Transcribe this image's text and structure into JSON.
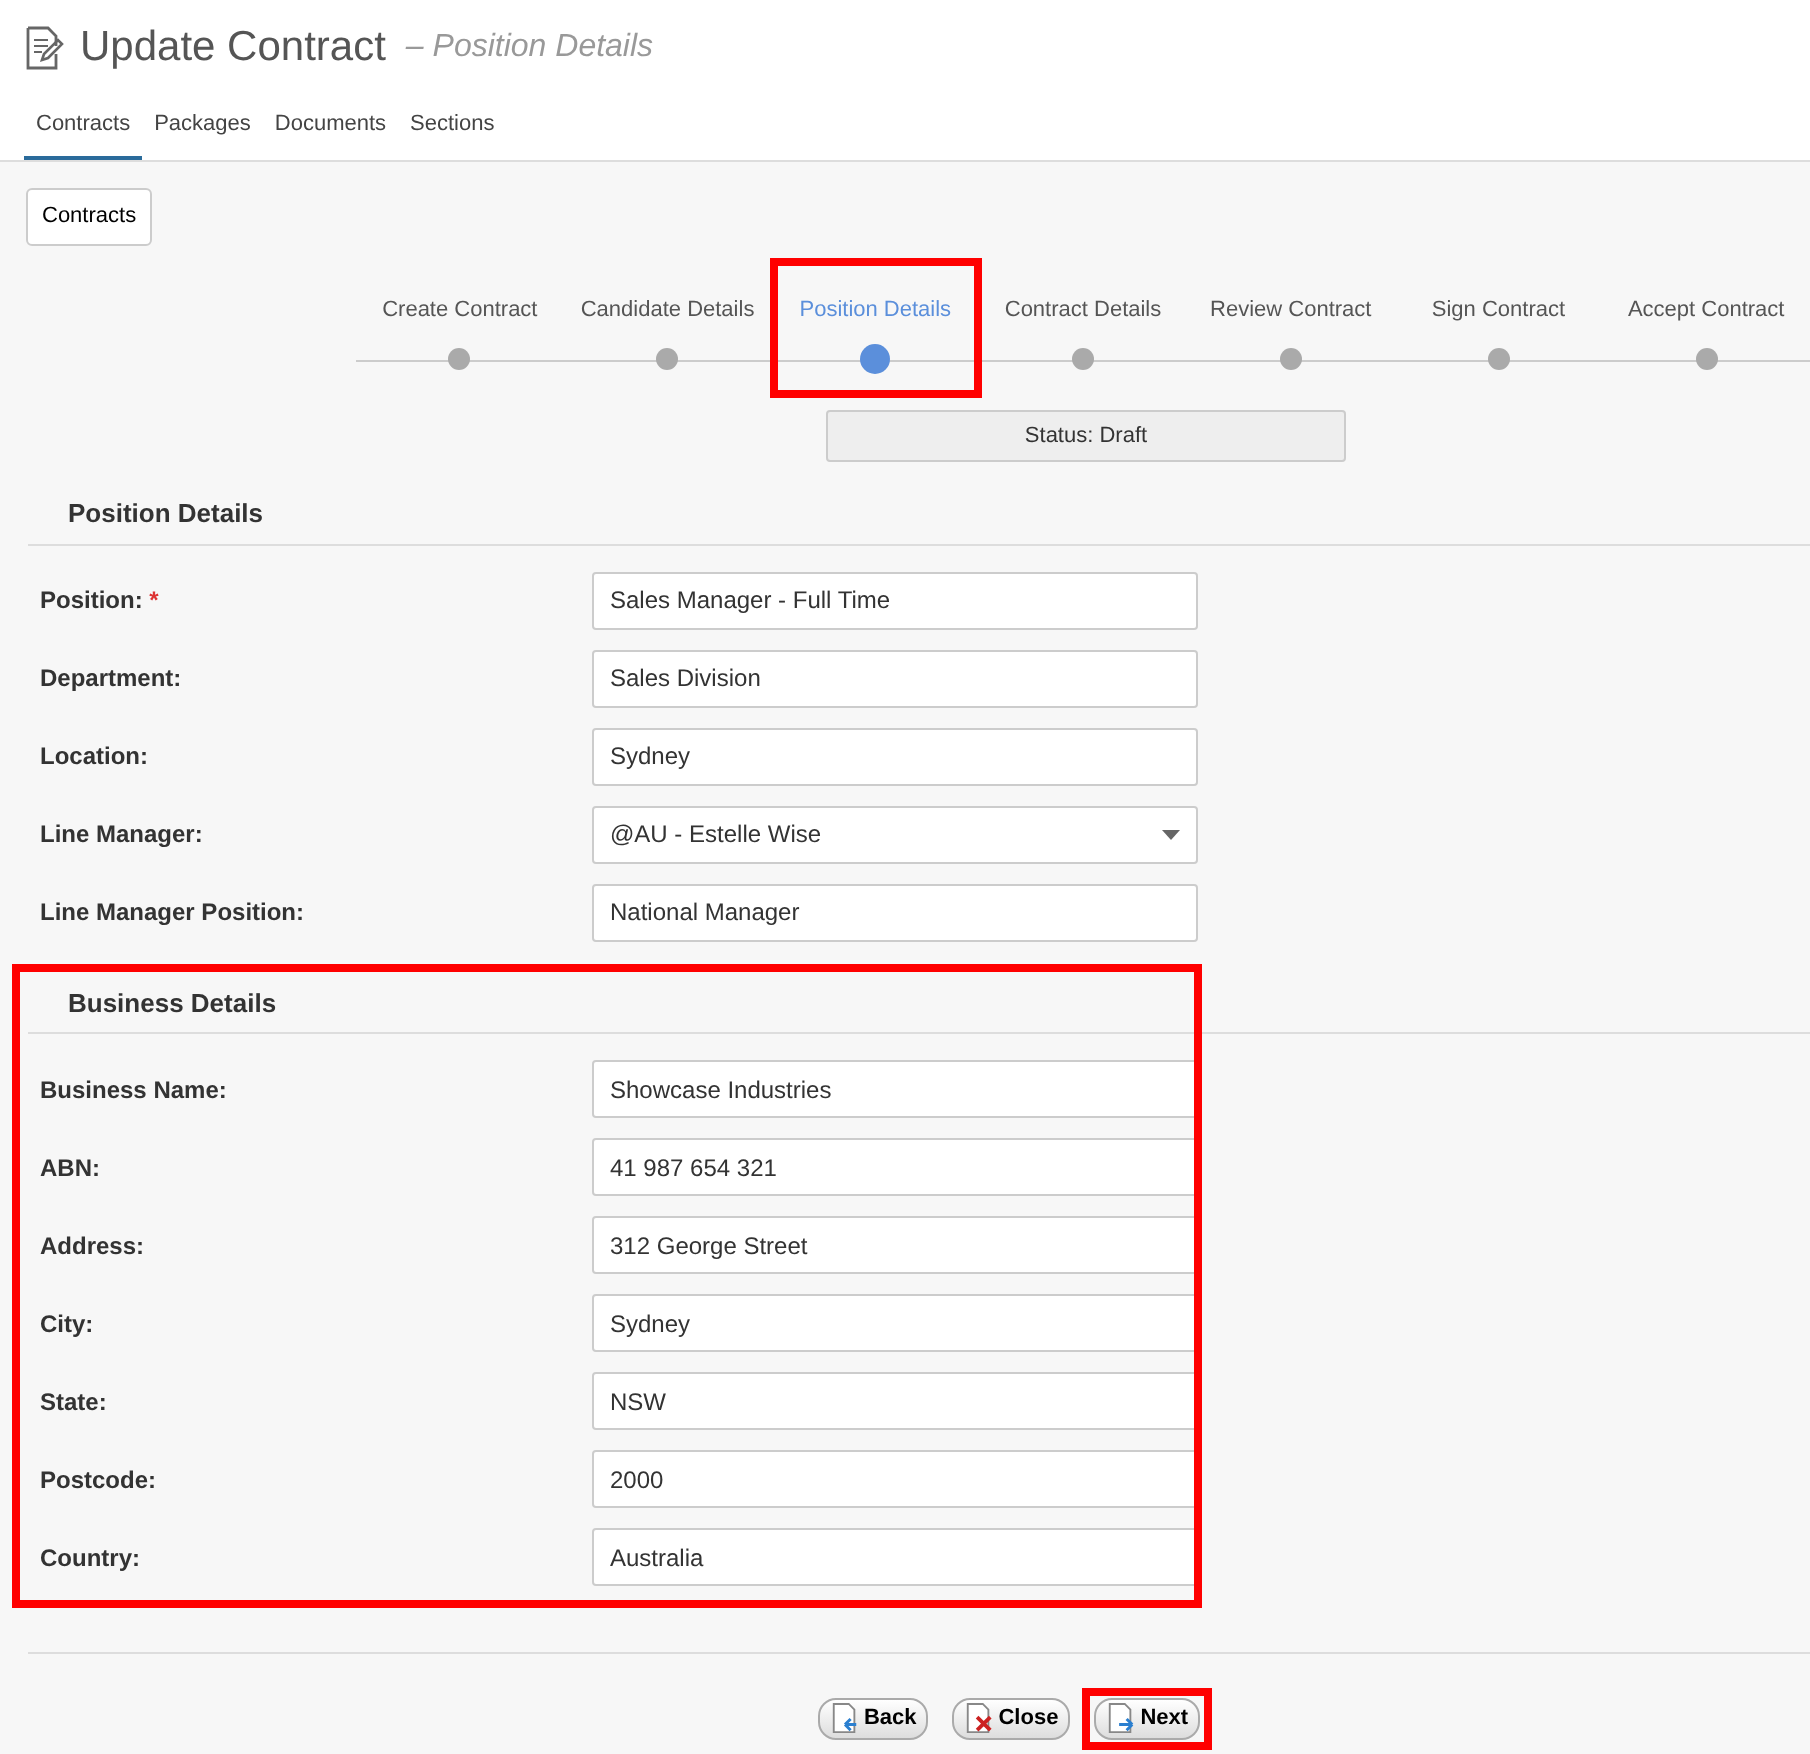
{
  "header": {
    "title": "Update Contract",
    "subtitle": "– Position Details"
  },
  "tabs": [
    {
      "label": "Contracts",
      "selected": true
    },
    {
      "label": "Packages",
      "selected": false
    },
    {
      "label": "Documents",
      "selected": false
    },
    {
      "label": "Sections",
      "selected": false
    }
  ],
  "breadcrumb_button": "Contracts",
  "steps": [
    {
      "label": "Create Contract",
      "selected": false,
      "highlighted": false
    },
    {
      "label": "Candidate Details",
      "selected": false,
      "highlighted": false
    },
    {
      "label": "Position Details",
      "selected": true,
      "highlighted": true
    },
    {
      "label": "Contract Details",
      "selected": false,
      "highlighted": false
    },
    {
      "label": "Review Contract",
      "selected": false,
      "highlighted": false
    },
    {
      "label": "Sign Contract",
      "selected": false,
      "highlighted": false
    },
    {
      "label": "Accept Contract",
      "selected": false,
      "highlighted": false
    }
  ],
  "status": "Status: Draft",
  "sections": [
    {
      "title": "Position Details",
      "highlighted": false,
      "fields": [
        {
          "label": "Position:",
          "required_mark": "*",
          "kind": "text",
          "value": "Sales Manager - Full Time"
        },
        {
          "label": "Department:",
          "kind": "text",
          "value": "Sales Division"
        },
        {
          "label": "Location:",
          "kind": "text",
          "value": "Sydney"
        },
        {
          "label": "Line Manager:",
          "kind": "select",
          "value": "@AU - Estelle Wise"
        },
        {
          "label": "Line Manager Position:",
          "kind": "text",
          "value": "National Manager"
        }
      ]
    },
    {
      "title": "Business Details",
      "highlighted": true,
      "fields": [
        {
          "label": "Business Name:",
          "kind": "text",
          "value": "Showcase Industries"
        },
        {
          "label": "ABN:",
          "kind": "text",
          "value": "41 987 654 321"
        },
        {
          "label": "Address:",
          "kind": "text",
          "value": "312 George Street"
        },
        {
          "label": "City:",
          "kind": "text",
          "value": "Sydney"
        },
        {
          "label": "State:",
          "kind": "text",
          "value": "NSW"
        },
        {
          "label": "Postcode:",
          "kind": "text",
          "value": "2000"
        },
        {
          "label": "Country:",
          "kind": "text",
          "value": "Australia"
        }
      ]
    }
  ],
  "buttons": [
    {
      "label": "Back",
      "kind": "back",
      "highlighted": false
    },
    {
      "label": "Close",
      "kind": "close",
      "highlighted": false
    },
    {
      "label": "Next",
      "kind": "next",
      "highlighted": true
    }
  ]
}
